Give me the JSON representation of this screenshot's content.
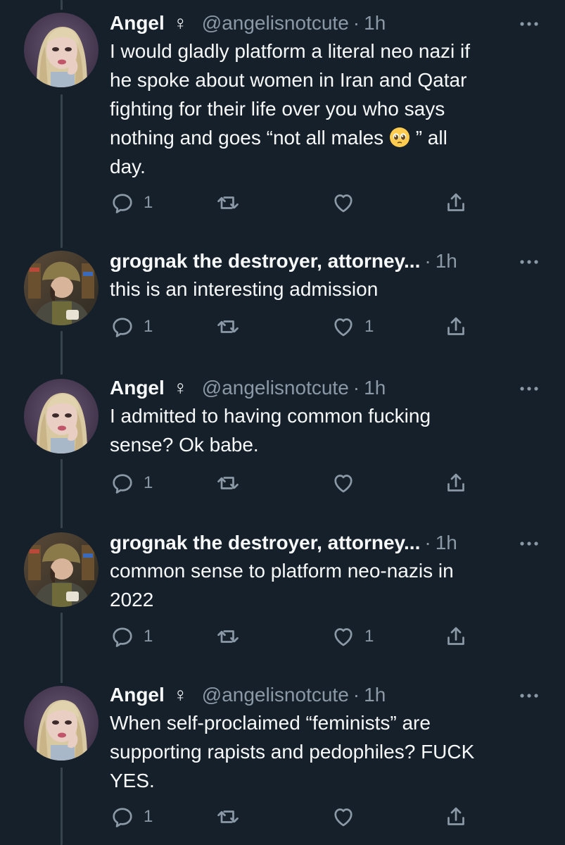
{
  "tweets": [
    {
      "author": "angel",
      "name": "Angel",
      "name_emoji": "♀",
      "handle": "@angelisnotcute",
      "separator": "·",
      "time": "1h",
      "text_before_emoji": "I would gladly platform a literal neo nazi if\nhe spoke about women in Iran and Qatar\nfighting for their life over you who says\nnothing and goes “not all males ",
      "text_emoji": "pleading-face-emoji",
      "text_after_emoji": " ” all\nday.",
      "reply_count": "1",
      "retweet_count": "",
      "like_count": ""
    },
    {
      "author": "grognak",
      "name": "grognak the destroyer, attorney...",
      "separator": "·",
      "time": "1h",
      "text": "this is an interesting admission",
      "reply_count": "1",
      "retweet_count": "",
      "like_count": "1"
    },
    {
      "author": "angel",
      "name": "Angel",
      "name_emoji": "♀",
      "handle": "@angelisnotcute",
      "separator": "·",
      "time": "1h",
      "text": "I admitted to having common fucking\nsense? Ok babe.",
      "reply_count": "1",
      "retweet_count": "",
      "like_count": ""
    },
    {
      "author": "grognak",
      "name": "grognak the destroyer, attorney...",
      "separator": "·",
      "time": "1h",
      "text": "common sense to platform neo-nazis in\n2022",
      "reply_count": "1",
      "retweet_count": "",
      "like_count": "1"
    },
    {
      "author": "angel",
      "name": "Angel",
      "name_emoji": "♀",
      "handle": "@angelisnotcute",
      "separator": "·",
      "time": "1h",
      "text": "When self-proclaimed “feminists” are\nsupporting rapists and pedophiles? FUCK\nYES.",
      "reply_count": "1",
      "retweet_count": "",
      "like_count": ""
    }
  ],
  "icons": {
    "reply": "reply-icon",
    "retweet": "retweet-icon",
    "like": "heart-icon",
    "share": "share-icon",
    "more": "more-icon"
  },
  "colors": {
    "background": "#15202b",
    "primary_text": "#f7f9f9",
    "secondary_text": "#8b98a5",
    "thread_line": "#38444d"
  }
}
